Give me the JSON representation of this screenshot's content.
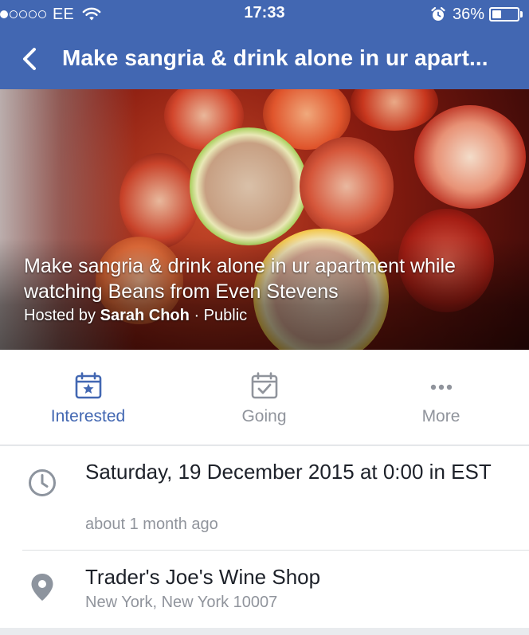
{
  "status_bar": {
    "signal_filled": 1,
    "signal_total": 5,
    "carrier": "EE",
    "time": "17:33",
    "battery_percent": "36%",
    "battery_level": 0.36
  },
  "nav": {
    "title": "Make sangria & drink alone in ur apart..."
  },
  "cover": {
    "title": "Make sangria & drink alone in ur apartment while watching Beans from Even Stevens",
    "hosted_by_prefix": "Hosted by",
    "host_name": "Sarah Choh",
    "separator": "·",
    "privacy": "Public"
  },
  "actions": [
    {
      "label": "Interested",
      "icon": "calendar-star-icon",
      "active": true
    },
    {
      "label": "Going",
      "icon": "calendar-check-icon",
      "active": false
    },
    {
      "label": "More",
      "icon": "more-dots-icon",
      "active": false
    }
  ],
  "details": {
    "time_main": "Saturday, 19 December 2015 at 0:00 in EST",
    "time_sub": "about 1 month ago",
    "location_name": "Trader's Joe's Wine Shop",
    "location_address": "New York, New York 10007"
  },
  "colors": {
    "brand": "#4267b2",
    "muted_text": "#90949c",
    "primary_text": "#1d2129",
    "icon_gray": "#8d949e"
  }
}
